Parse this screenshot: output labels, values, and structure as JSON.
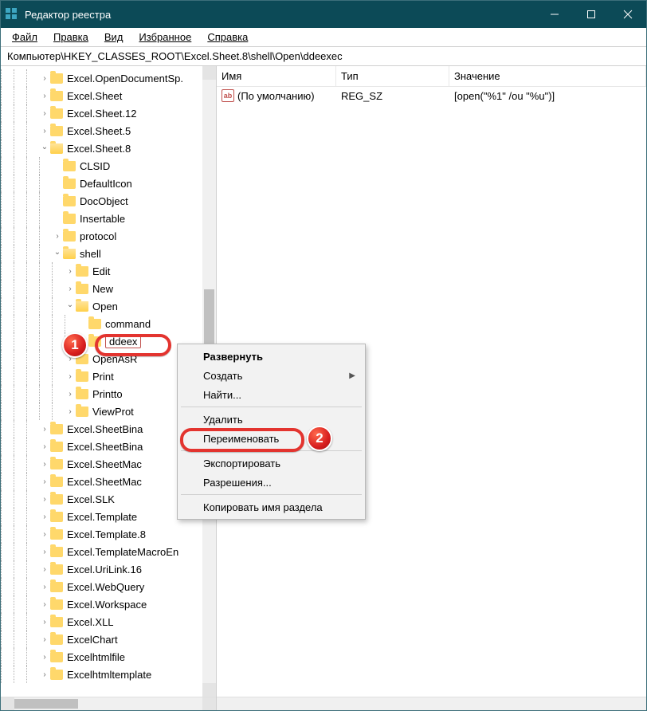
{
  "window": {
    "title": "Редактор реестра"
  },
  "menu": {
    "file": "Файл",
    "edit": "Правка",
    "view": "Вид",
    "favorites": "Избранное",
    "help": "Справка"
  },
  "address": "Компьютер\\HKEY_CLASSES_ROOT\\Excel.Sheet.8\\shell\\Open\\ddeexec",
  "columns": {
    "name": "Имя",
    "type": "Тип",
    "value": "Значение"
  },
  "values": [
    {
      "icon": "ab",
      "name": "(По умолчанию)",
      "type": "REG_SZ",
      "data": "[open(\"%1\" /ou \"%u\")]"
    }
  ],
  "tree": [
    {
      "d": 3,
      "exp": ">",
      "label": "Excel.OpenDocumentSp."
    },
    {
      "d": 3,
      "exp": ">",
      "label": "Excel.Sheet"
    },
    {
      "d": 3,
      "exp": ">",
      "label": "Excel.Sheet.12"
    },
    {
      "d": 3,
      "exp": ">",
      "label": "Excel.Sheet.5"
    },
    {
      "d": 3,
      "exp": "v",
      "label": "Excel.Sheet.8"
    },
    {
      "d": 4,
      "exp": "",
      "label": "CLSID"
    },
    {
      "d": 4,
      "exp": "",
      "label": "DefaultIcon"
    },
    {
      "d": 4,
      "exp": "",
      "label": "DocObject"
    },
    {
      "d": 4,
      "exp": "",
      "label": "Insertable"
    },
    {
      "d": 4,
      "exp": ">",
      "label": "protocol"
    },
    {
      "d": 4,
      "exp": "v",
      "label": "shell"
    },
    {
      "d": 5,
      "exp": ">",
      "label": "Edit"
    },
    {
      "d": 5,
      "exp": ">",
      "label": "New"
    },
    {
      "d": 5,
      "exp": "v",
      "label": "Open"
    },
    {
      "d": 6,
      "exp": "",
      "label": "command"
    },
    {
      "d": 6,
      "exp": "",
      "label": "ddeex",
      "sel": true
    },
    {
      "d": 5,
      "exp": ">",
      "label": "OpenAsR"
    },
    {
      "d": 5,
      "exp": ">",
      "label": "Print"
    },
    {
      "d": 5,
      "exp": ">",
      "label": "Printto"
    },
    {
      "d": 5,
      "exp": ">",
      "label": "ViewProt"
    },
    {
      "d": 3,
      "exp": ">",
      "label": "Excel.SheetBina"
    },
    {
      "d": 3,
      "exp": ">",
      "label": "Excel.SheetBina"
    },
    {
      "d": 3,
      "exp": ">",
      "label": "Excel.SheetMac"
    },
    {
      "d": 3,
      "exp": ">",
      "label": "Excel.SheetMac"
    },
    {
      "d": 3,
      "exp": ">",
      "label": "Excel.SLK"
    },
    {
      "d": 3,
      "exp": ">",
      "label": "Excel.Template"
    },
    {
      "d": 3,
      "exp": ">",
      "label": "Excel.Template.8"
    },
    {
      "d": 3,
      "exp": ">",
      "label": "Excel.TemplateMacroEn"
    },
    {
      "d": 3,
      "exp": ">",
      "label": "Excel.UriLink.16"
    },
    {
      "d": 3,
      "exp": ">",
      "label": "Excel.WebQuery"
    },
    {
      "d": 3,
      "exp": ">",
      "label": "Excel.Workspace"
    },
    {
      "d": 3,
      "exp": ">",
      "label": "Excel.XLL"
    },
    {
      "d": 3,
      "exp": ">",
      "label": "ExcelChart"
    },
    {
      "d": 3,
      "exp": ">",
      "label": "Excelhtmlfile"
    },
    {
      "d": 3,
      "exp": ">",
      "label": "Excelhtmltemplate"
    }
  ],
  "context_menu": {
    "expand": "Развернуть",
    "create": "Создать",
    "find": "Найти...",
    "delete": "Удалить",
    "rename": "Переименовать",
    "export": "Экспортировать",
    "permissions": "Разрешения...",
    "copy_key_name": "Копировать имя раздела"
  },
  "callouts": {
    "one": "1",
    "two": "2"
  }
}
